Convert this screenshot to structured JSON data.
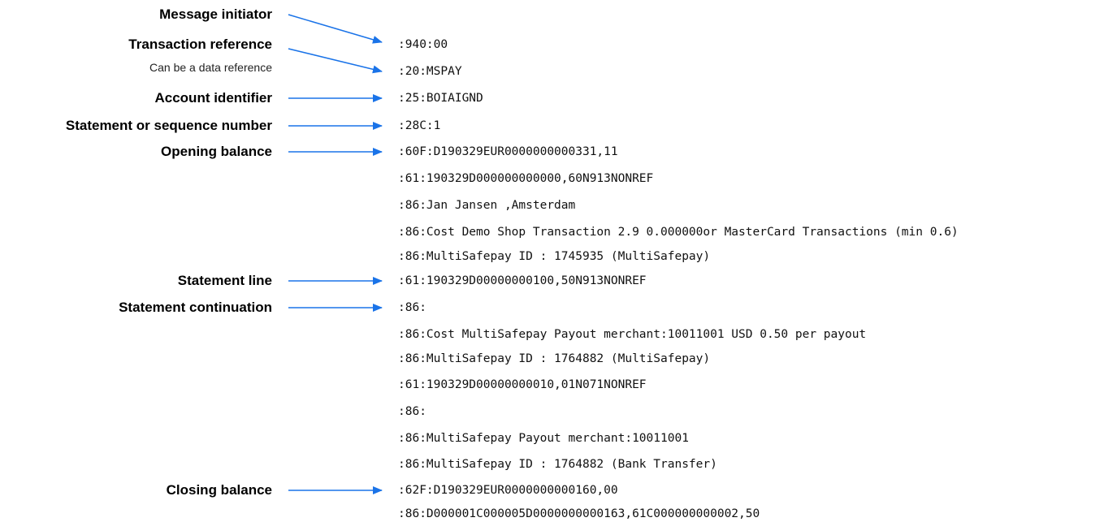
{
  "colors": {
    "arrow": "#1a73e8",
    "text": "#000000"
  },
  "labels": {
    "message_initiator": "Message initiator",
    "transaction_reference": "Transaction reference",
    "transaction_reference_note": "Can be a data reference",
    "account_identifier": "Account identifier",
    "statement_number": "Statement or sequence number",
    "opening_balance": "Opening balance",
    "statement_line": "Statement line",
    "statement_continuation": "Statement continuation",
    "closing_balance": "Closing balance"
  },
  "lines": [
    ":940:00",
    ":20:MSPAY",
    ":25:BOIAIGND",
    ":28C:1",
    ":60F:D190329EUR0000000000331,11",
    ":61:190329D000000000000,60N913NONREF",
    ":86:Jan Jansen ,Amsterdam",
    ":86:Cost Demo Shop Transaction 2.9 0.000000or MasterCard Transactions (min 0.6)",
    ":86:MultiSafepay ID : 1745935 (MultiSafepay)",
    ":61:190329D00000000100,50N913NONREF",
    ":86:",
    ":86:Cost MultiSafepay Payout merchant:10011001 USD 0.50 per payout",
    ":86:MultiSafepay ID : 1764882 (MultiSafepay)",
    ":61:190329D00000000010,01N071NONREF",
    ":86:",
    ":86:MultiSafepay Payout merchant:10011001",
    ":86:MultiSafepay ID : 1764882 (Bank Transfer)",
    ":62F:D190329EUR0000000000160,00",
    ":86:D000001C000005D0000000000163,61C000000000002,50"
  ]
}
